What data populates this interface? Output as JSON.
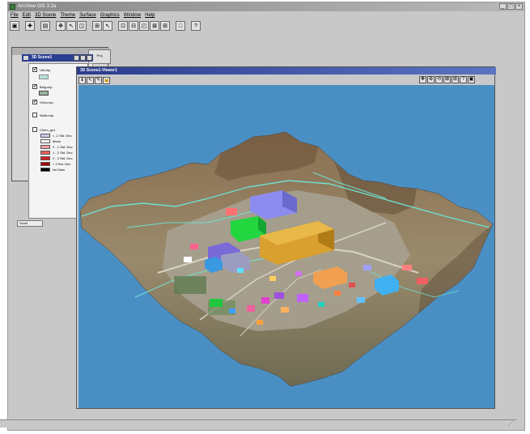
{
  "app": {
    "title": "ArcView GIS 3.2a",
    "window_controls": [
      "_",
      "□",
      "×"
    ]
  },
  "menubar": {
    "items": [
      "File",
      "Edit",
      "3D Scene",
      "Theme",
      "Surface",
      "Graphics",
      "Window",
      "Help"
    ]
  },
  "toolbar": {
    "icons": [
      "save-icon",
      "add-theme-icon",
      "theme-properties-icon",
      "navigate-icon",
      "zoom-in-icon",
      "zoom-out-icon",
      "full-extent-icon",
      "pan-icon",
      "select-icon",
      "identify-icon",
      "layout-icon",
      "help-icon"
    ]
  },
  "toc": {
    "title": "3D Scene1",
    "side_tab": "Proj",
    "themes": [
      {
        "label": "Util.shp",
        "checked": true
      },
      {
        "label": "Bldg.shp",
        "checked": true
      },
      {
        "label": "Ortho.tan",
        "checked": true
      },
      {
        "label": "Walls.shp",
        "checked": false
      }
    ],
    "grid_theme": {
      "label": "Chem_grd",
      "classes": [
        {
          "label": "< -1 Std. Dev.",
          "color": "#c8c8f0"
        },
        {
          "label": "Mean",
          "color": "#ffffff"
        },
        {
          "label": "0 - 1 Std. Dev.",
          "color": "#f4a0a0"
        },
        {
          "label": "1 - 2 Std. Dev.",
          "color": "#ea6060"
        },
        {
          "label": "2 - 3 Std. Dev.",
          "color": "#d82020"
        },
        {
          "label": "> 3 Std. Dev.",
          "color": "#a80000"
        },
        {
          "label": "No Data",
          "color": "#000000"
        }
      ]
    },
    "bottom_tab": "Scroll"
  },
  "viewer": {
    "title": "3D Scene1-Viewer1",
    "sky_color": "#4a8fc4"
  }
}
